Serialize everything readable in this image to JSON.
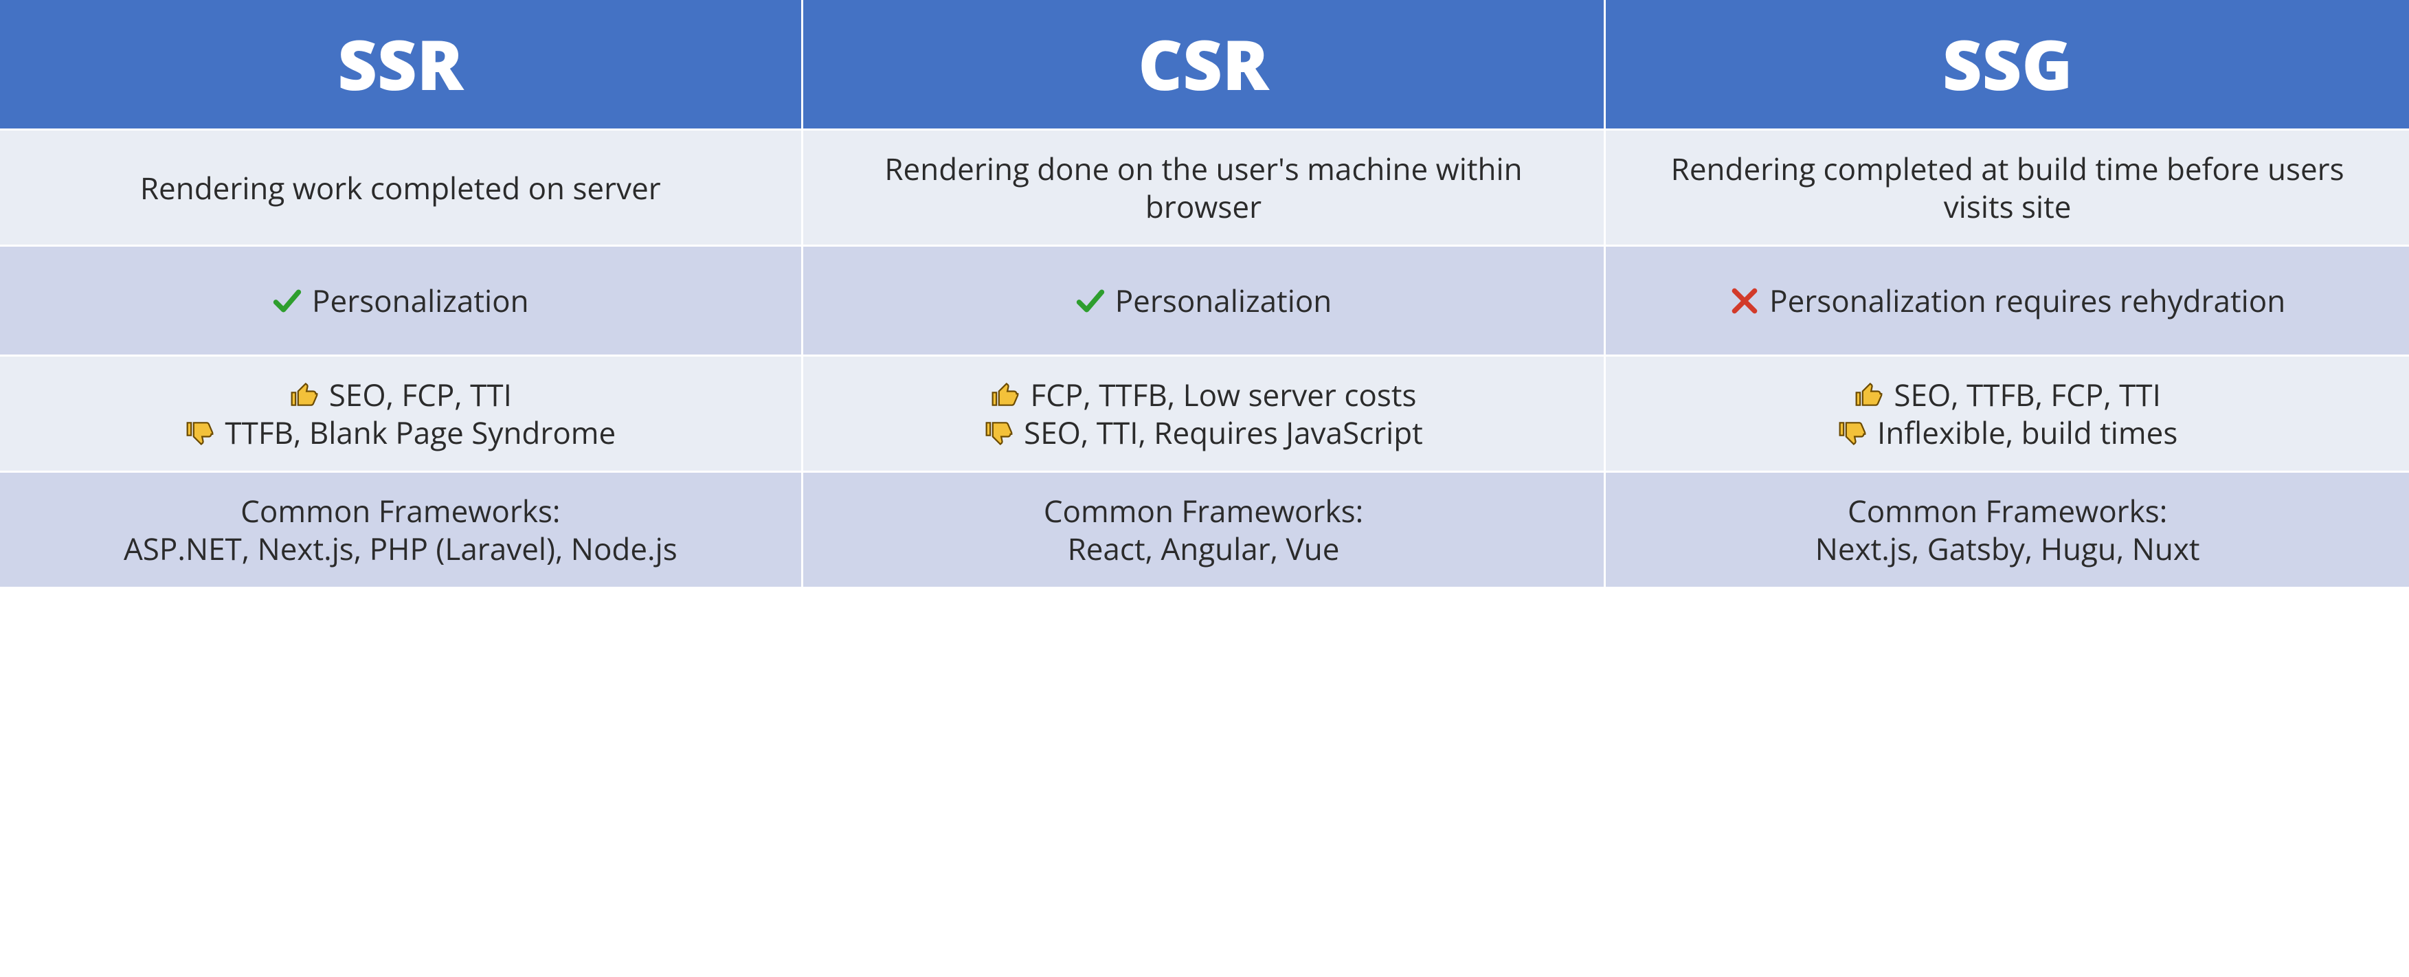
{
  "columns": [
    {
      "key": "ssr",
      "title": "SSR"
    },
    {
      "key": "csr",
      "title": "CSR"
    },
    {
      "key": "ssg",
      "title": "SSG"
    }
  ],
  "rows": {
    "description": {
      "ssr": "Rendering work completed on server",
      "csr": "Rendering done on the user's machine within browser",
      "ssg": "Rendering completed at build time before users visits site"
    },
    "personalization": {
      "ssr": {
        "icon": "check",
        "text": "Personalization"
      },
      "csr": {
        "icon": "check",
        "text": "Personalization"
      },
      "ssg": {
        "icon": "cross",
        "text": "Personalization requires rehydration"
      }
    },
    "pros_cons": {
      "ssr": {
        "pro": "SEO, FCP, TTI",
        "con": "TTFB, Blank Page Syndrome"
      },
      "csr": {
        "pro": "FCP, TTFB, Low server costs",
        "con": "SEO, TTI, Requires JavaScript"
      },
      "ssg": {
        "pro": "SEO, TTFB, FCP, TTI",
        "con": "Inflexible, build times"
      }
    },
    "frameworks": {
      "label": "Common Frameworks:",
      "ssr": "ASP.NET, Next.js, PHP (Laravel), Node.js",
      "csr": "React, Angular, Vue",
      "ssg": "Next.js, Gatsby, Hugu, Nuxt"
    }
  },
  "icons": {
    "check": "check-icon",
    "cross": "cross-icon",
    "thumbs_up": "thumbs-up-icon",
    "thumbs_down": "thumbs-down-icon"
  }
}
